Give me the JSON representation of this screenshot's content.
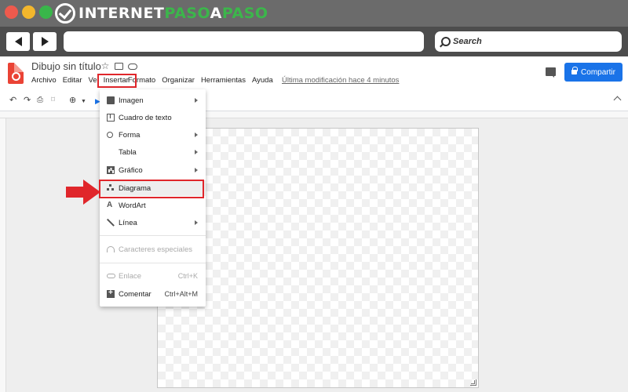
{
  "browser": {
    "brand": {
      "part1": "INTERNET",
      "part2": "PASO",
      "part3": "A",
      "part4": "PASO"
    },
    "search_label": "Search"
  },
  "doc": {
    "title": "Dibujo sin título",
    "menu": [
      "Archivo",
      "Editar",
      "Ve",
      "Insertar",
      "Formato",
      "Organizar",
      "Herramientas",
      "Ayuda"
    ],
    "last_modified": "Última modificación hace 4 minutos",
    "share_label": "Compartir"
  },
  "toolbar": {
    "zoom_symbol": "⊕"
  },
  "insert_menu": {
    "items": [
      {
        "label": "Imagen",
        "icon": "image-icon",
        "submenu": true,
        "shortcut": ""
      },
      {
        "label": "Cuadro de texto",
        "icon": "textbox-icon",
        "submenu": false,
        "shortcut": ""
      },
      {
        "label": "Forma",
        "icon": "shape-icon",
        "submenu": true,
        "shortcut": ""
      },
      {
        "label": "Tabla",
        "icon": "",
        "submenu": true,
        "shortcut": ""
      },
      {
        "label": "Gráfico",
        "icon": "chart-icon",
        "submenu": true,
        "shortcut": ""
      },
      {
        "label": "Diagrama",
        "icon": "diagram-icon",
        "submenu": false,
        "shortcut": ""
      },
      {
        "label": "WordArt",
        "icon": "wordart-icon",
        "submenu": false,
        "shortcut": ""
      },
      {
        "label": "Línea",
        "icon": "line-icon",
        "submenu": true,
        "shortcut": ""
      },
      {
        "label": "Caracteres especiales",
        "icon": "special-characters-icon",
        "submenu": false,
        "shortcut": "",
        "disabled": true
      },
      {
        "label": "Enlace",
        "icon": "link-icon",
        "submenu": false,
        "shortcut": "Ctrl+K",
        "disabled": true
      },
      {
        "label": "Comentar",
        "icon": "comment-add-icon",
        "submenu": false,
        "shortcut": "Ctrl+Alt+M"
      }
    ]
  },
  "colors": {
    "highlight_red": "#e0262b",
    "share_blue": "#1a73e8",
    "brand_green": "#3cb64b",
    "docs_red": "#ea4335"
  }
}
